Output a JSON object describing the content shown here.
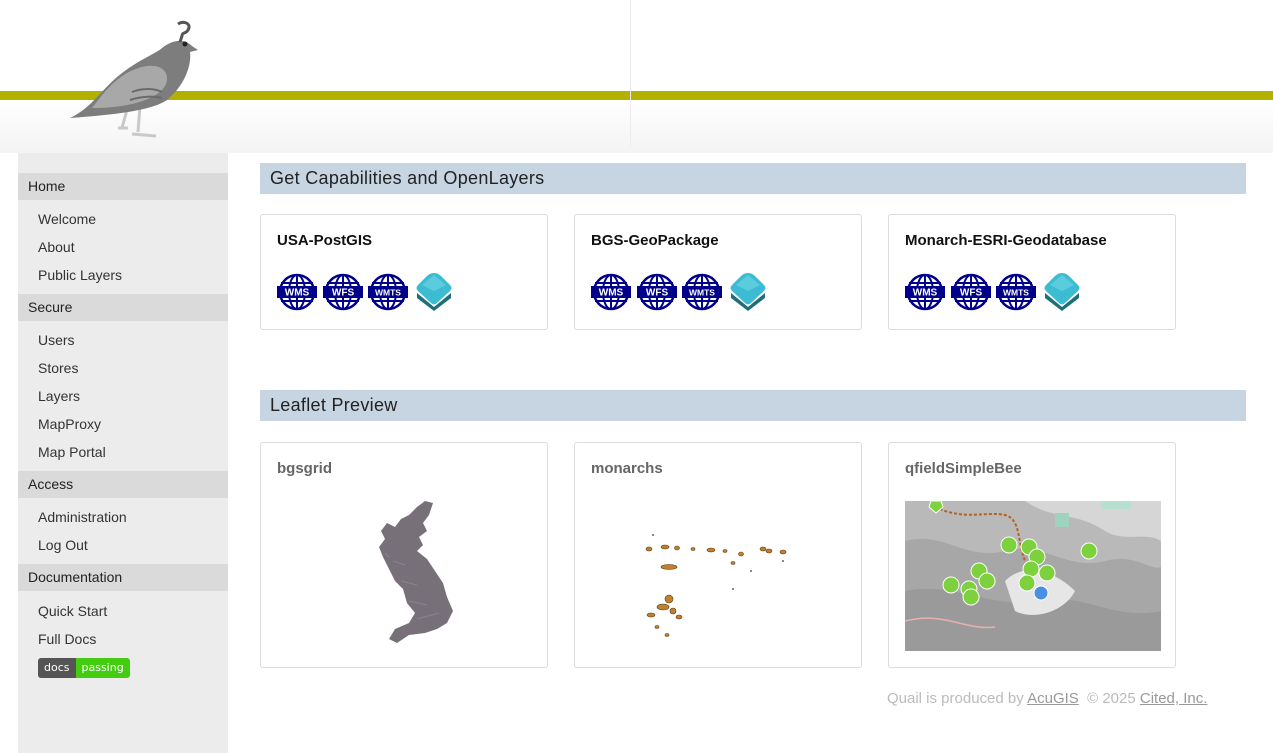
{
  "sidebar": {
    "sections": [
      {
        "title": "Home",
        "items": [
          "Welcome",
          "About",
          "Public Layers"
        ]
      },
      {
        "title": "Secure",
        "items": [
          "Users",
          "Stores",
          "Layers",
          "MapProxy",
          "Map Portal"
        ]
      },
      {
        "title": "Access",
        "items": [
          "Administration",
          "Log Out"
        ]
      },
      {
        "title": "Documentation",
        "items": [
          "Quick Start",
          "Full Docs"
        ]
      }
    ],
    "badge": {
      "left": "docs",
      "right": "passing"
    }
  },
  "main": {
    "capabilities": {
      "title": "Get Capabilities and OpenLayers",
      "cards": [
        {
          "title": "USA-PostGIS"
        },
        {
          "title": "BGS-GeoPackage"
        },
        {
          "title": "Monarch-ESRI-Geodatabase"
        }
      ],
      "service_labels": [
        "WMS",
        "WFS",
        "WMTS"
      ]
    },
    "leaflet": {
      "title": "Leaflet Preview",
      "cards": [
        {
          "title": "bgsgrid"
        },
        {
          "title": "monarchs"
        },
        {
          "title": "qfieldSimpleBee"
        }
      ]
    }
  },
  "footer": {
    "prefix": "Quail is produced by ",
    "link1": "AcuGIS",
    "middle": "  © 2025 ",
    "link2": "Cited, Inc."
  },
  "colors": {
    "band": "#b2b100",
    "section_bg": "#c7d5e2",
    "badge_pass": "#44cc11",
    "globe": "#00008b"
  }
}
